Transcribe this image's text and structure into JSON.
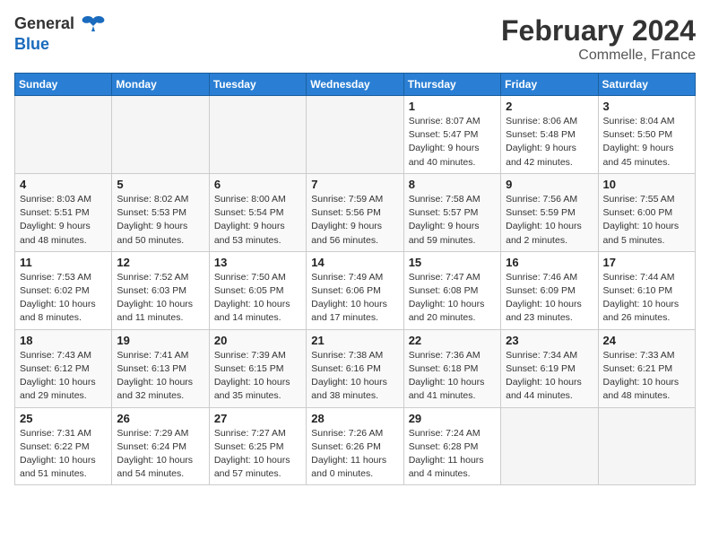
{
  "header": {
    "logo_general": "General",
    "logo_blue": "Blue",
    "month_year": "February 2024",
    "location": "Commelle, France"
  },
  "weekdays": [
    "Sunday",
    "Monday",
    "Tuesday",
    "Wednesday",
    "Thursday",
    "Friday",
    "Saturday"
  ],
  "weeks": [
    [
      {
        "day": "",
        "info": ""
      },
      {
        "day": "",
        "info": ""
      },
      {
        "day": "",
        "info": ""
      },
      {
        "day": "",
        "info": ""
      },
      {
        "day": "1",
        "info": "Sunrise: 8:07 AM\nSunset: 5:47 PM\nDaylight: 9 hours\nand 40 minutes."
      },
      {
        "day": "2",
        "info": "Sunrise: 8:06 AM\nSunset: 5:48 PM\nDaylight: 9 hours\nand 42 minutes."
      },
      {
        "day": "3",
        "info": "Sunrise: 8:04 AM\nSunset: 5:50 PM\nDaylight: 9 hours\nand 45 minutes."
      }
    ],
    [
      {
        "day": "4",
        "info": "Sunrise: 8:03 AM\nSunset: 5:51 PM\nDaylight: 9 hours\nand 48 minutes."
      },
      {
        "day": "5",
        "info": "Sunrise: 8:02 AM\nSunset: 5:53 PM\nDaylight: 9 hours\nand 50 minutes."
      },
      {
        "day": "6",
        "info": "Sunrise: 8:00 AM\nSunset: 5:54 PM\nDaylight: 9 hours\nand 53 minutes."
      },
      {
        "day": "7",
        "info": "Sunrise: 7:59 AM\nSunset: 5:56 PM\nDaylight: 9 hours\nand 56 minutes."
      },
      {
        "day": "8",
        "info": "Sunrise: 7:58 AM\nSunset: 5:57 PM\nDaylight: 9 hours\nand 59 minutes."
      },
      {
        "day": "9",
        "info": "Sunrise: 7:56 AM\nSunset: 5:59 PM\nDaylight: 10 hours\nand 2 minutes."
      },
      {
        "day": "10",
        "info": "Sunrise: 7:55 AM\nSunset: 6:00 PM\nDaylight: 10 hours\nand 5 minutes."
      }
    ],
    [
      {
        "day": "11",
        "info": "Sunrise: 7:53 AM\nSunset: 6:02 PM\nDaylight: 10 hours\nand 8 minutes."
      },
      {
        "day": "12",
        "info": "Sunrise: 7:52 AM\nSunset: 6:03 PM\nDaylight: 10 hours\nand 11 minutes."
      },
      {
        "day": "13",
        "info": "Sunrise: 7:50 AM\nSunset: 6:05 PM\nDaylight: 10 hours\nand 14 minutes."
      },
      {
        "day": "14",
        "info": "Sunrise: 7:49 AM\nSunset: 6:06 PM\nDaylight: 10 hours\nand 17 minutes."
      },
      {
        "day": "15",
        "info": "Sunrise: 7:47 AM\nSunset: 6:08 PM\nDaylight: 10 hours\nand 20 minutes."
      },
      {
        "day": "16",
        "info": "Sunrise: 7:46 AM\nSunset: 6:09 PM\nDaylight: 10 hours\nand 23 minutes."
      },
      {
        "day": "17",
        "info": "Sunrise: 7:44 AM\nSunset: 6:10 PM\nDaylight: 10 hours\nand 26 minutes."
      }
    ],
    [
      {
        "day": "18",
        "info": "Sunrise: 7:43 AM\nSunset: 6:12 PM\nDaylight: 10 hours\nand 29 minutes."
      },
      {
        "day": "19",
        "info": "Sunrise: 7:41 AM\nSunset: 6:13 PM\nDaylight: 10 hours\nand 32 minutes."
      },
      {
        "day": "20",
        "info": "Sunrise: 7:39 AM\nSunset: 6:15 PM\nDaylight: 10 hours\nand 35 minutes."
      },
      {
        "day": "21",
        "info": "Sunrise: 7:38 AM\nSunset: 6:16 PM\nDaylight: 10 hours\nand 38 minutes."
      },
      {
        "day": "22",
        "info": "Sunrise: 7:36 AM\nSunset: 6:18 PM\nDaylight: 10 hours\nand 41 minutes."
      },
      {
        "day": "23",
        "info": "Sunrise: 7:34 AM\nSunset: 6:19 PM\nDaylight: 10 hours\nand 44 minutes."
      },
      {
        "day": "24",
        "info": "Sunrise: 7:33 AM\nSunset: 6:21 PM\nDaylight: 10 hours\nand 48 minutes."
      }
    ],
    [
      {
        "day": "25",
        "info": "Sunrise: 7:31 AM\nSunset: 6:22 PM\nDaylight: 10 hours\nand 51 minutes."
      },
      {
        "day": "26",
        "info": "Sunrise: 7:29 AM\nSunset: 6:24 PM\nDaylight: 10 hours\nand 54 minutes."
      },
      {
        "day": "27",
        "info": "Sunrise: 7:27 AM\nSunset: 6:25 PM\nDaylight: 10 hours\nand 57 minutes."
      },
      {
        "day": "28",
        "info": "Sunrise: 7:26 AM\nSunset: 6:26 PM\nDaylight: 11 hours\nand 0 minutes."
      },
      {
        "day": "29",
        "info": "Sunrise: 7:24 AM\nSunset: 6:28 PM\nDaylight: 11 hours\nand 4 minutes."
      },
      {
        "day": "",
        "info": ""
      },
      {
        "day": "",
        "info": ""
      }
    ]
  ]
}
